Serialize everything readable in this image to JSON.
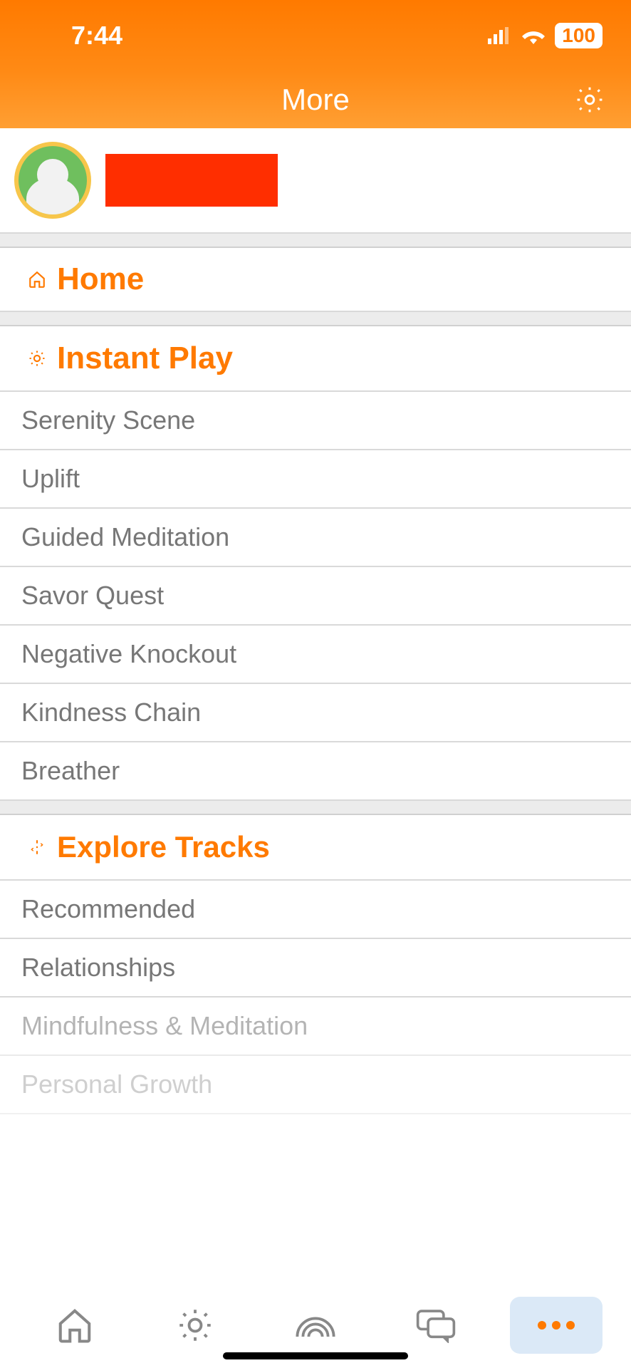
{
  "status": {
    "time": "7:44",
    "battery": "100"
  },
  "header": {
    "title": "More"
  },
  "sections": {
    "home": {
      "label": "Home"
    },
    "instant": {
      "label": "Instant Play",
      "items": [
        "Serenity Scene",
        "Uplift",
        "Guided Meditation",
        "Savor Quest",
        "Negative Knockout",
        "Kindness Chain",
        "Breather"
      ]
    },
    "explore": {
      "label": "Explore Tracks",
      "items": [
        "Recommended",
        "Relationships",
        "Mindfulness & Meditation",
        "Personal Growth"
      ]
    }
  },
  "colors": {
    "accent": "#ff7a00"
  }
}
